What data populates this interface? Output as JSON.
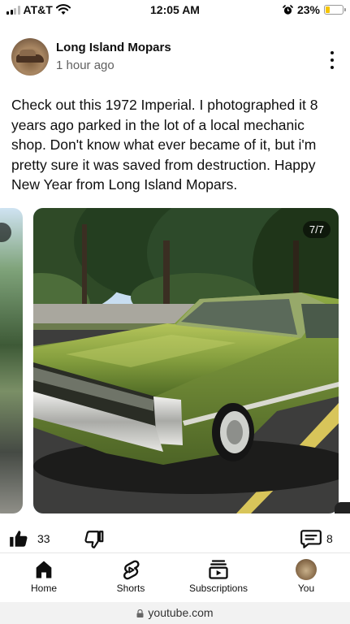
{
  "status_bar": {
    "carrier": "AT&T",
    "time": "12:05 AM",
    "battery_percent": "23%",
    "battery_level": 0.23,
    "wifi_icon": "wifi-icon",
    "alarm_icon": "alarm-icon"
  },
  "channel": {
    "name": "Long Island Mopars",
    "time_ago": "1 hour ago"
  },
  "post": {
    "text": "Check out this 1972 Imperial. I photographed it 8 years ago parked in the lot of a local mechanic shop. Don't know what ever became of it, but i'm pretty sure it was saved from destruction. Happy New Year from Long Island Mopars."
  },
  "carousel": {
    "counter": "7/7",
    "car_color": "#7f9a3c"
  },
  "engagement": {
    "like_count": "33",
    "comment_count": "8"
  },
  "nav": {
    "items": [
      {
        "label": "Home",
        "icon": "home-icon"
      },
      {
        "label": "Shorts",
        "icon": "shorts-icon"
      },
      {
        "label": "Subscriptions",
        "icon": "subscriptions-icon"
      },
      {
        "label": "You",
        "icon": "avatar"
      }
    ]
  },
  "browser": {
    "url": "youtube.com"
  }
}
